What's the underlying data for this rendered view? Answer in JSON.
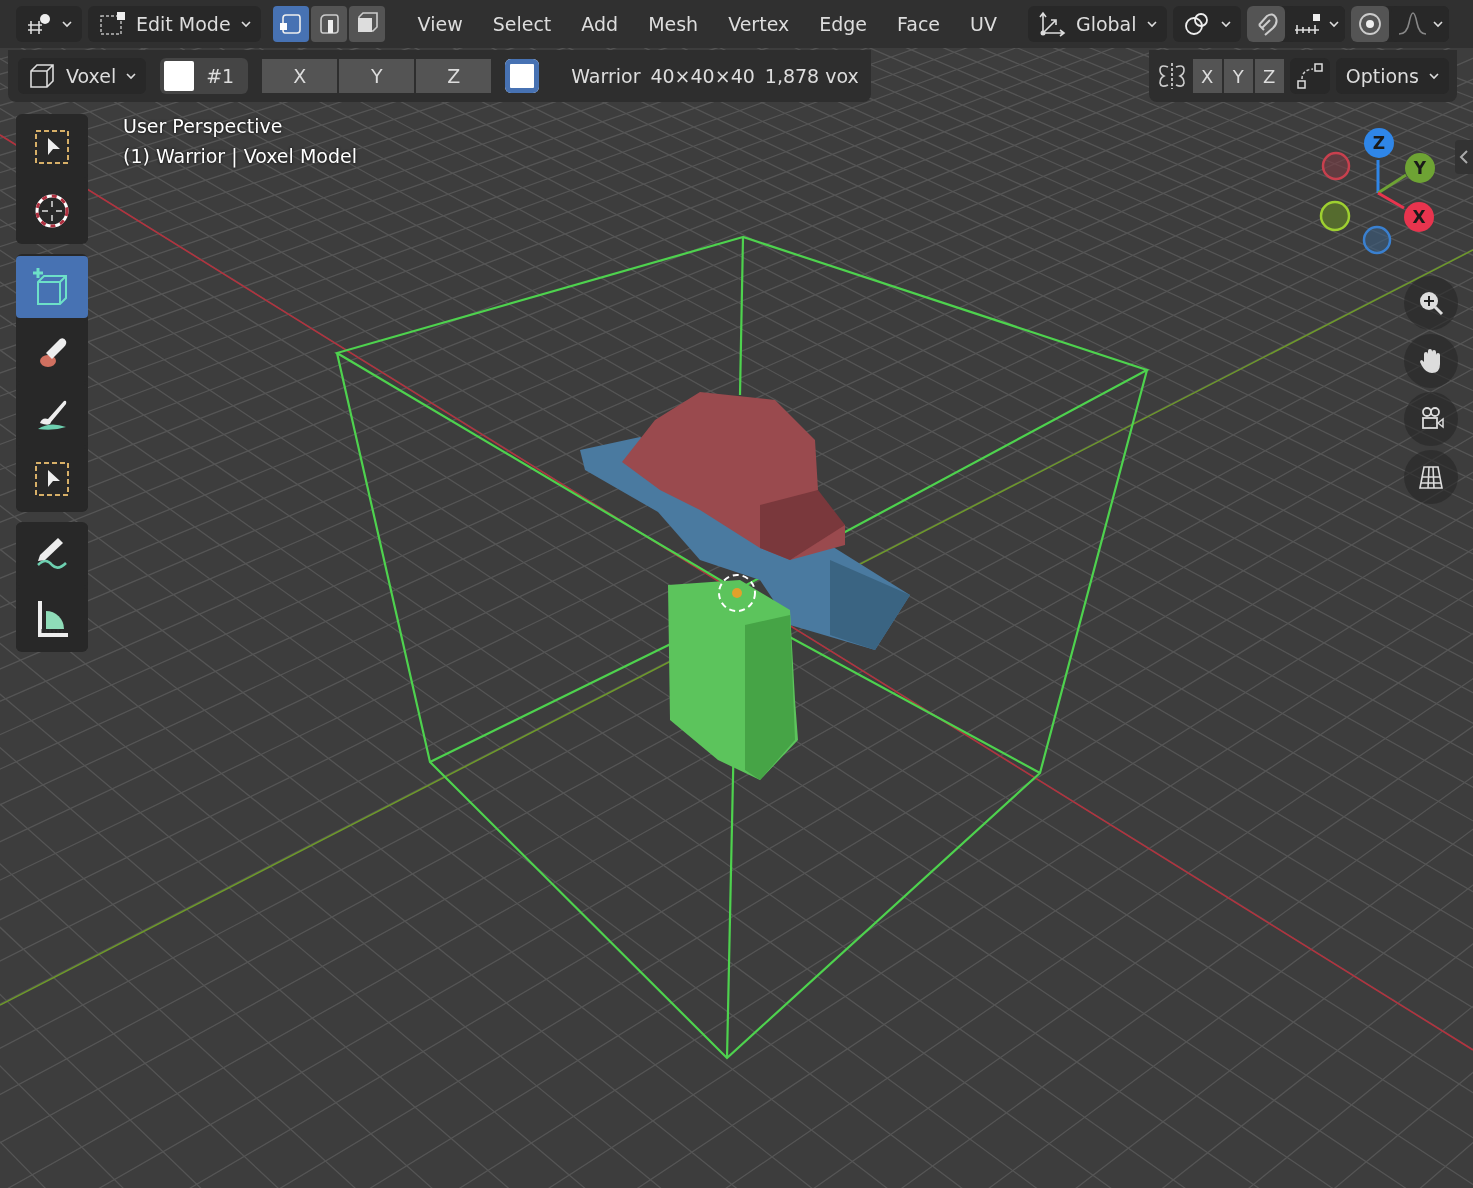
{
  "header": {
    "mode": "Edit Mode",
    "select_modes": [
      {
        "kind": "vertex",
        "selected": true
      },
      {
        "kind": "edge",
        "selected": false
      },
      {
        "kind": "face",
        "selected": false
      }
    ],
    "menus": [
      "View",
      "Select",
      "Add",
      "Mesh",
      "Vertex",
      "Edge",
      "Face",
      "UV"
    ],
    "orientation": "Global",
    "snapping": {
      "on": true
    },
    "proportional": {
      "on": true
    }
  },
  "tool_settings": {
    "brush": "Voxel",
    "color_index": "#1",
    "axes": [
      "X",
      "Y",
      "Z"
    ],
    "checkbox_checked": true,
    "info": [
      "Warrior",
      "40×40×40",
      "1,878 vox"
    ],
    "mirror_axes": [
      "X",
      "Y",
      "Z"
    ],
    "options": "Options"
  },
  "viewport": {
    "overlay_lines": [
      "User Perspective",
      "(1) Warrior | Voxel Model"
    ],
    "gizmo_axes": [
      "Z",
      "Y",
      "X"
    ]
  },
  "tool_groups": [
    {
      "tools": [
        {
          "kind": "select",
          "selected": false
        },
        {
          "kind": "cursor",
          "selected": false
        }
      ]
    },
    {
      "tools": [
        {
          "kind": "add",
          "selected": true
        },
        {
          "kind": "erase",
          "selected": false
        },
        {
          "kind": "paint",
          "selected": false
        },
        {
          "kind": "select",
          "selected": false
        }
      ]
    },
    {
      "tools": [
        {
          "kind": "annotate",
          "selected": false
        },
        {
          "kind": "measure",
          "selected": false
        }
      ]
    }
  ]
}
